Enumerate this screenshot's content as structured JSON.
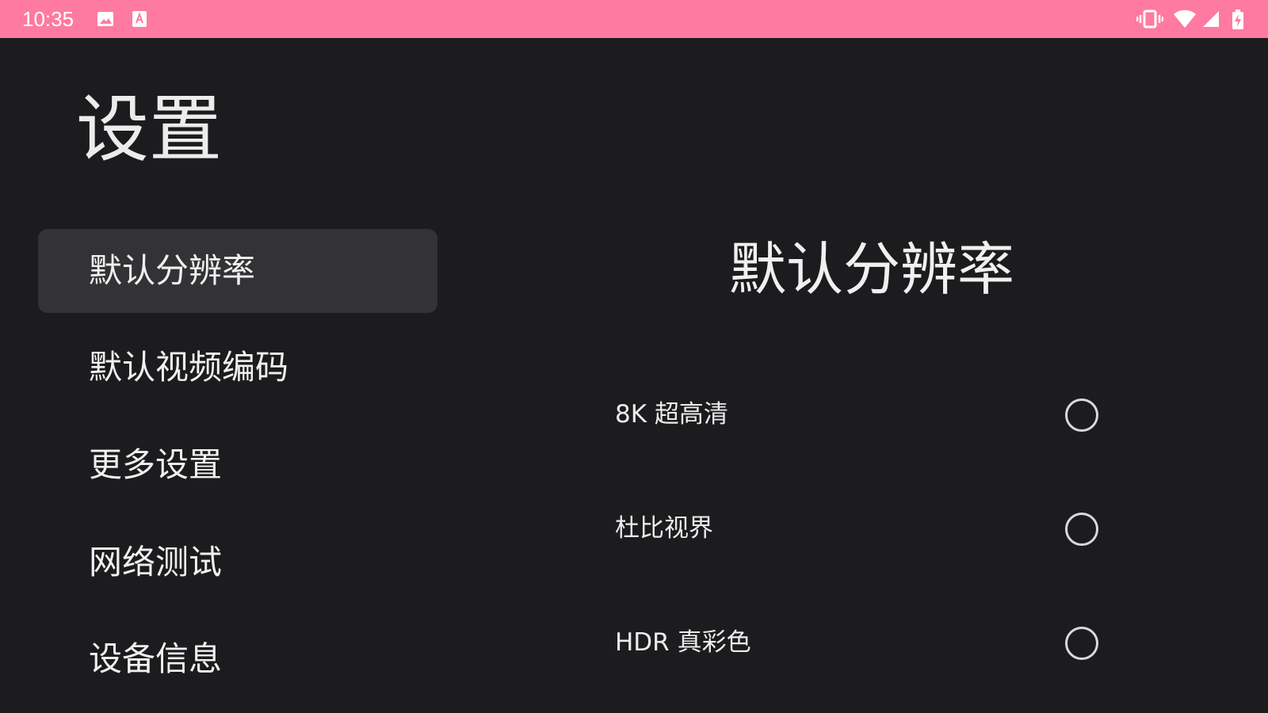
{
  "status_bar": {
    "time": "10:35",
    "left_icons": [
      "image-icon",
      "text-a-icon"
    ],
    "right_icons": [
      "vibrate-icon",
      "wifi-icon",
      "signal-icon",
      "battery-charging-icon"
    ],
    "background_color": "#ff7aa0"
  },
  "page": {
    "title": "设置"
  },
  "sidebar": {
    "items": [
      {
        "label": "默认分辨率",
        "selected": true
      },
      {
        "label": "默认视频编码",
        "selected": false
      },
      {
        "label": "更多设置",
        "selected": false
      },
      {
        "label": "网络测试",
        "selected": false
      },
      {
        "label": "设备信息",
        "selected": false
      }
    ]
  },
  "content": {
    "title": "默认分辨率",
    "options": [
      {
        "label": "8K 超高清",
        "selected": false
      },
      {
        "label": "杜比视界",
        "selected": false
      },
      {
        "label": "HDR 真彩色",
        "selected": false
      }
    ]
  }
}
